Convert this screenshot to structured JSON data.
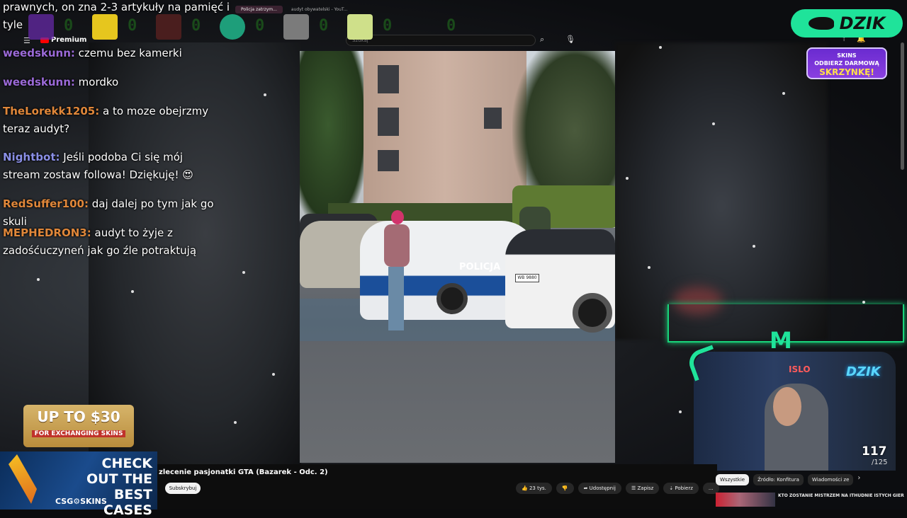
{
  "browser": {
    "tabs": [
      {
        "label": "Policja zatrzym..."
      },
      {
        "label": "audyt obywatelski - YouT..."
      }
    ]
  },
  "youtube": {
    "logo_label": "Premium",
    "search_placeholder": "Szukaj",
    "video_title": "zlecenie pasjonatki GTA (Bazarek - Odc. 2)",
    "subscribe_label": "Subskrybuj",
    "actions": [
      {
        "label": "23 tys."
      },
      {
        "label": ""
      },
      {
        "label": "Udostępnij"
      },
      {
        "label": "Zapisz"
      },
      {
        "label": "Pobierz"
      },
      {
        "label": "..."
      }
    ],
    "filters": [
      {
        "label": "Wszystkie",
        "active": true
      },
      {
        "label": "Źródło: Konfitura",
        "active": false
      },
      {
        "label": "Wiadomości ze",
        "active": false
      }
    ],
    "next_video": "KTO ZOSTANIE MISTRZEM NA ITHUDNIE ISTYCH GIER",
    "police_label": "POLICJA",
    "plate": "WB 9880"
  },
  "chat": {
    "messages": [
      {
        "user": "",
        "text": "prawnych, on zna 2-3 artykuły na pamięć i tyle",
        "color": "#ffffff"
      },
      {
        "user": "weedskunn:",
        "text": "czemu bez kamerki",
        "color": "#9b6ad8"
      },
      {
        "user": "weedskunn:",
        "text": "mordko",
        "color": "#9b6ad8"
      },
      {
        "user": "TheLorekk1205:",
        "text": "a to moze obejrzmy teraz audyt?",
        "color": "#e0873a"
      },
      {
        "user": "Nightbot:",
        "text": "Jeśli podoba Ci się mój stream zostaw followa! Dziękuję! 😍",
        "color": "#8a8fe6"
      },
      {
        "user": "RedSuffer100:",
        "text": "daj dalej po tym jak go skuli",
        "color": "#e0873a"
      },
      {
        "user": "MEPHEDRON3:",
        "text": "audyt to żyje z zadośćuczyneń jak go źle potraktują",
        "color": "#e0873a"
      }
    ]
  },
  "hud": {
    "counters": [
      {
        "value": "0",
        "block_color": "#6b2bb0"
      },
      {
        "value": "0",
        "block_color": "#e6c61e"
      },
      {
        "value": "0",
        "block_color": "#4a1e1e"
      },
      {
        "value": "0",
        "block_color": "#1e9e7a"
      },
      {
        "value": "0",
        "block_color": "#7b7b7b"
      },
      {
        "value": "0",
        "block_color": "#cfe08a"
      },
      {
        "value": "0",
        "block_color": "transparent"
      }
    ]
  },
  "overlay": {
    "brand": "DZIK",
    "promo_small": "SKINS",
    "promo_line1": "ODBIERZ DARMOWĄ",
    "promo_line2": "SKRZYNKĘ!",
    "cam_neon": "DZIK",
    "cam_neon2": "ISLO",
    "m_logo": "M",
    "sub_count": "117",
    "sub_goal": "/125"
  },
  "ads": {
    "ad1_line1": "UP TO $30",
    "ad1_line2": "FOR EXCHANGING SKINS",
    "ad2_line1": "CHECK OUT THE BEST CASES",
    "ad2_brand": "CSG⚙SKINS"
  },
  "colors": {
    "accent_green": "#1fe39a",
    "promo_purple": "#7b35d8",
    "police_blue": "#1b4f9a"
  }
}
